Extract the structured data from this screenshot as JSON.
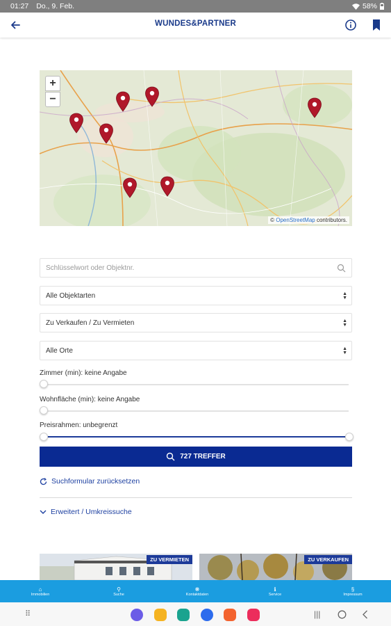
{
  "status_bar": {
    "time": "01:27",
    "date": "Do., 9. Feb.",
    "battery": "58%"
  },
  "app_bar": {
    "title": "WUNDES&PARTNER",
    "icons": [
      "back-arrow-icon",
      "info-icon",
      "bookmark-icon"
    ]
  },
  "map": {
    "zoom_in": "+",
    "zoom_out": "−",
    "attribution_prefix": "©",
    "attribution_link": "OpenStreetMap",
    "attribution_suffix": "contributors."
  },
  "search": {
    "placeholder": "Schlüsselwort oder Objektnr.",
    "type_select": "Alle Objektarten",
    "offer_select": "Zu Verkaufen / Zu Vermieten",
    "location_select": "Alle Orte"
  },
  "filters": {
    "rooms_label": "Zimmer (min): keine Angabe",
    "area_label": "Wohnfläche (min): keine Angabe",
    "price_label": "Preisrahmen: unbegrenzt"
  },
  "results_button": "727 TREFFER",
  "reset_link": "Suchformular zurücksetzen",
  "extended_link": "Erweitert / Umkreissuche",
  "cards": [
    {
      "badge": "ZU VERMIETEN"
    },
    {
      "badge": "ZU VERKAUFEN"
    }
  ],
  "bottom_nav": [
    {
      "label": "Immobilien",
      "icon": "home-icon"
    },
    {
      "label": "Suche",
      "icon": "search-icon"
    },
    {
      "label": "Kontaktdaten",
      "icon": "contact-icon"
    },
    {
      "label": "Service",
      "icon": "service-icon"
    },
    {
      "label": "Impressum",
      "icon": "imprint-icon"
    }
  ],
  "colors": {
    "primary": "#0a2a92",
    "bottom_nav": "#1b9de0",
    "pin": "#b0182a"
  }
}
